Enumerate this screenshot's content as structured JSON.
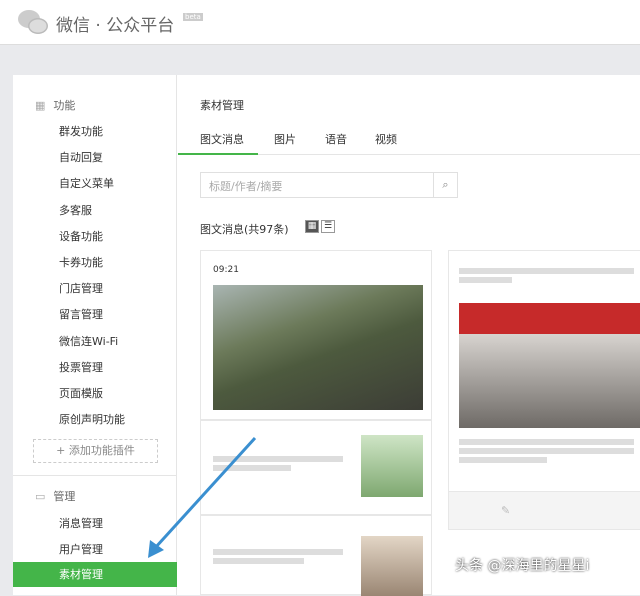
{
  "header": {
    "title": "微信 · 公众平台",
    "beta": "beta"
  },
  "sidebar": {
    "section1": "功能",
    "items1": [
      "群发功能",
      "自动回复",
      "自定义菜单",
      "多客服",
      "设备功能",
      "卡券功能",
      "门店管理",
      "留言管理",
      "微信连Wi-Fi",
      "投票管理",
      "页面模版",
      "原创声明功能"
    ],
    "add_plugin": "+ 添加功能插件",
    "section2": "管理",
    "items2": [
      "消息管理",
      "用户管理"
    ],
    "active": "素材管理"
  },
  "main": {
    "heading": "素材管理",
    "tabs": [
      "图文消息",
      "图片",
      "语音",
      "视频"
    ],
    "search_placeholder": "标题/作者/摘要",
    "count": "图文消息(共97条)",
    "card_time": "09:21"
  },
  "watermark": "头条 @深海里的星星i",
  "colors": {
    "accent": "#44b549",
    "arrow": "#3a8fd0"
  }
}
